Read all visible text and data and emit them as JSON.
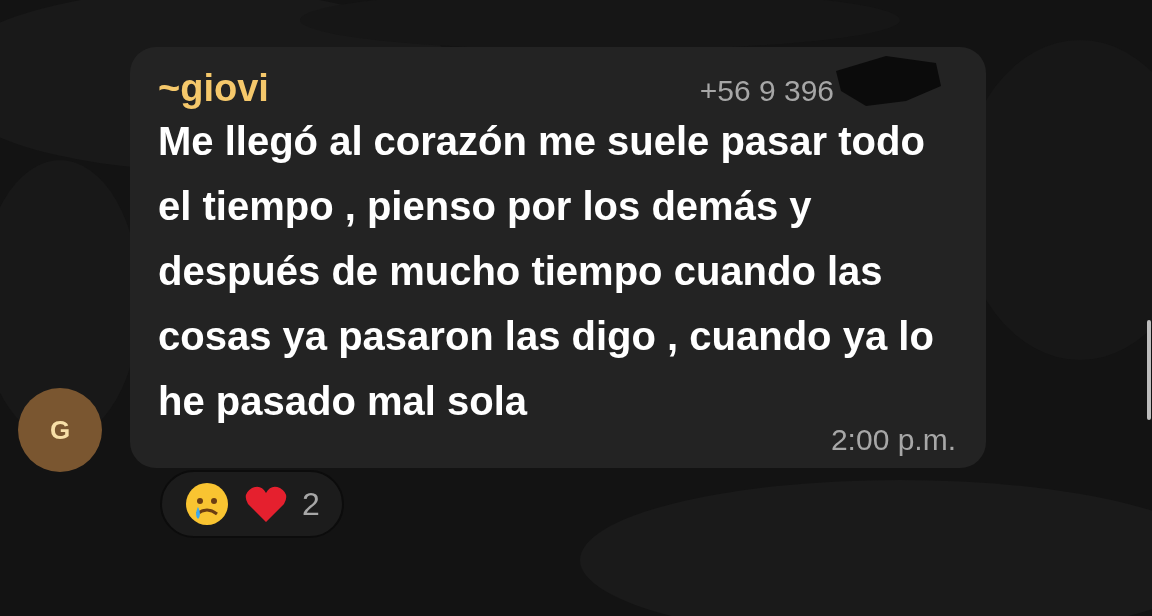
{
  "message": {
    "avatar_initial": "G",
    "sender": "~giovi",
    "phone": "+56 9 396",
    "text": "Me llegó al corazón me suele pasar todo el tiempo , pienso por los demás y después de mucho tiempo cuando las cosas ya pasaron las digo , cuando ya lo he pasado mal sola",
    "time": "2:00 p.m.",
    "reactions": {
      "count": "2"
    }
  }
}
